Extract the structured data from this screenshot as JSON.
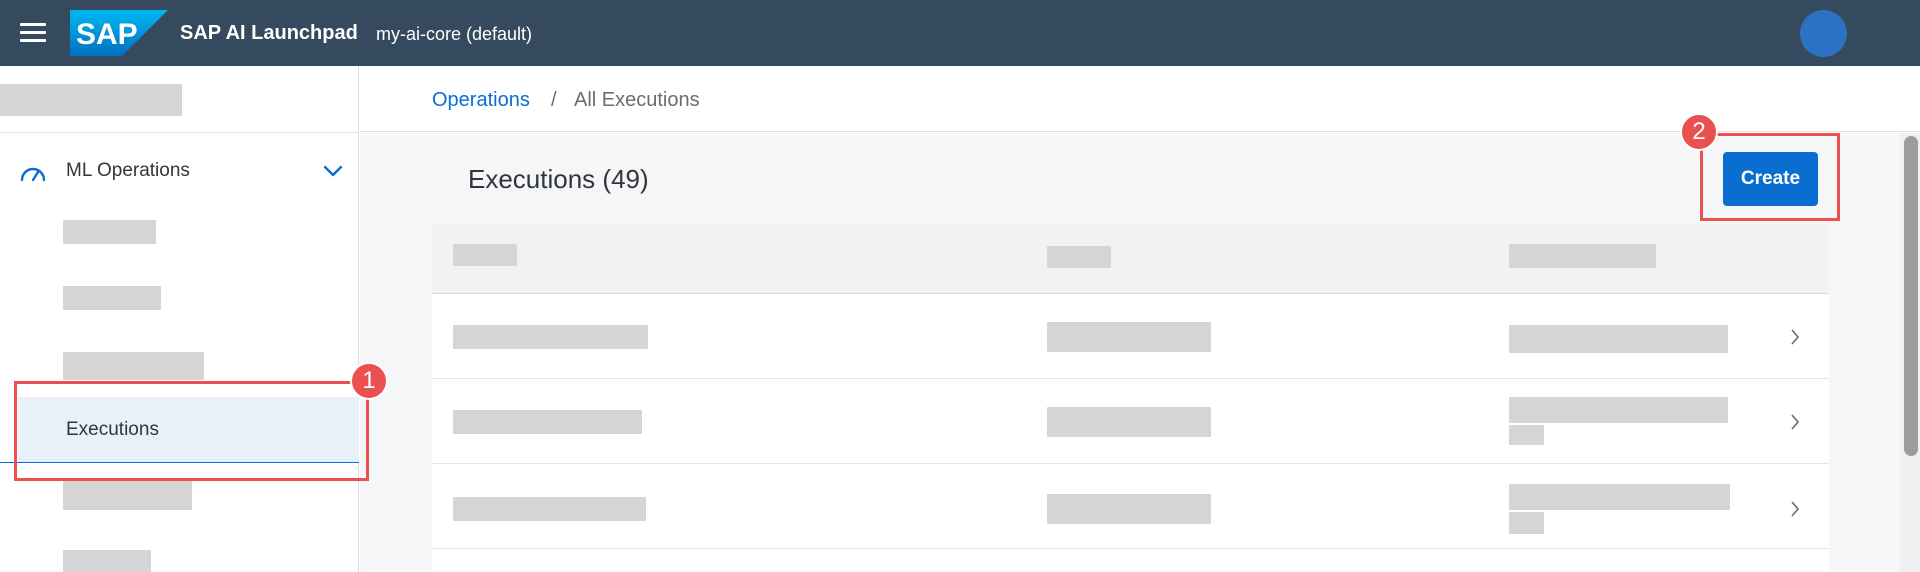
{
  "shell": {
    "logo_text": "SAP",
    "app_title": "SAP AI Launchpad",
    "context": "my-ai-core (default)"
  },
  "sidebar": {
    "group_label": "ML Operations",
    "active_item": "Executions"
  },
  "breadcrumb": {
    "parent": "Operations",
    "separator": "/",
    "current": "All Executions"
  },
  "main": {
    "title": "Executions (49)",
    "create_label": "Create"
  },
  "annotations": {
    "marker_1": "1",
    "marker_2": "2"
  },
  "colors": {
    "shell": "#354a5f",
    "accent": "#0a6ed1",
    "annotation": "#e9504f"
  },
  "icons": [
    "menu-icon",
    "gauge-icon",
    "chevron-down-icon",
    "chevron-right-icon"
  ]
}
